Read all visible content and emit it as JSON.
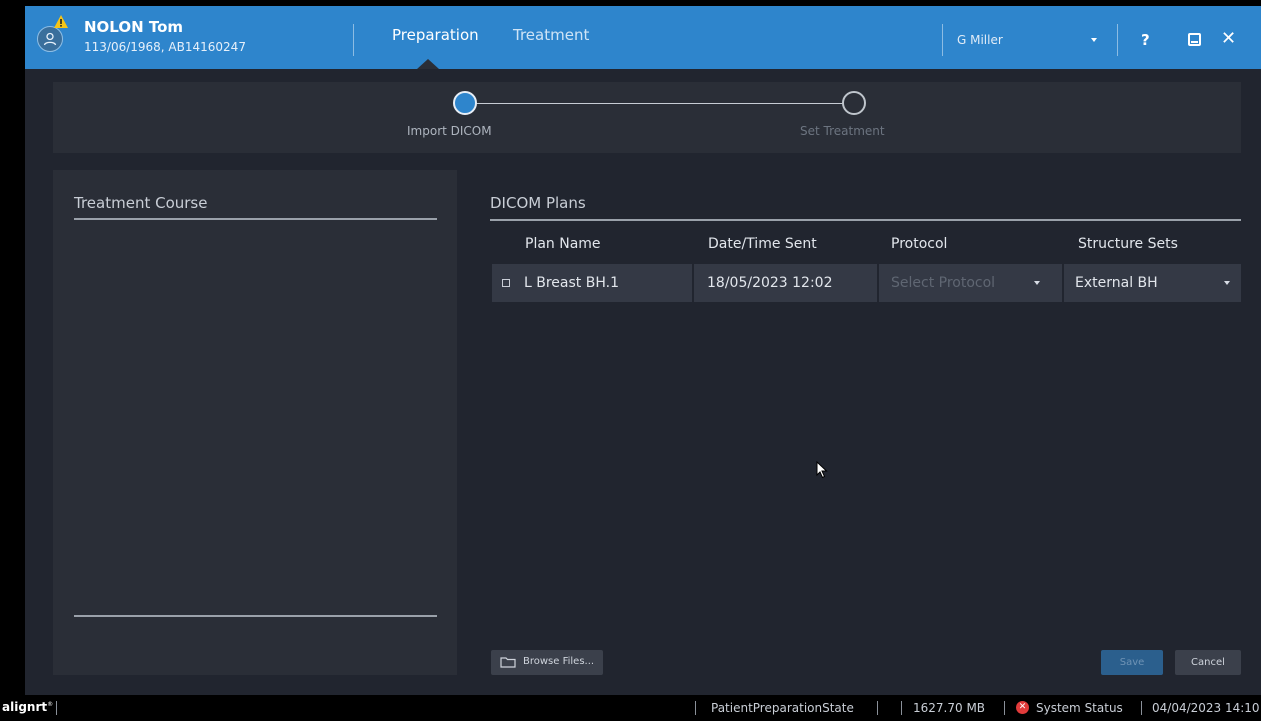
{
  "header": {
    "patient_name": "NOLON Tom",
    "patient_details": "113/06/1968, AB14160247",
    "tabs": [
      {
        "label": "Preparation",
        "active": true
      },
      {
        "label": "Treatment",
        "active": false
      }
    ],
    "user": "G Miller",
    "help_label": "?",
    "close_label": "✕"
  },
  "stepper": {
    "steps": [
      {
        "label": "Import DICOM",
        "state": "active"
      },
      {
        "label": "Set Treatment",
        "state": "inactive"
      }
    ]
  },
  "treatment_course": {
    "title": "Treatment Course"
  },
  "dicom_plans": {
    "title": "DICOM Plans",
    "columns": [
      "Plan Name",
      "Date/Time Sent",
      "Protocol",
      "Structure Sets"
    ],
    "rows": [
      {
        "plan_name": "L Breast BH.1",
        "date_sent": "18/05/2023 12:02",
        "protocol_placeholder": "Select Protocol",
        "structure_set": "External BH"
      }
    ]
  },
  "buttons": {
    "browse": "Browse Files...",
    "save": "Save",
    "cancel": "Cancel"
  },
  "statusbar": {
    "logo": "alignrt",
    "logo_mark": "®",
    "state": "PatientPreparationState",
    "memory": "1627.70 MB",
    "system_status": "System Status",
    "datetime": "04/04/2023 14:10"
  },
  "colors": {
    "accent": "#2e85cc",
    "background": "#21252f",
    "panel": "#2a2e37",
    "row": "#343945",
    "error": "#e23b3b",
    "warning": "#f5c518"
  },
  "icons": [
    "user-icon",
    "warning-icon",
    "minimize-icon",
    "close-icon",
    "folder-icon",
    "chevron-down-icon",
    "error-icon",
    "mouse-cursor"
  ]
}
